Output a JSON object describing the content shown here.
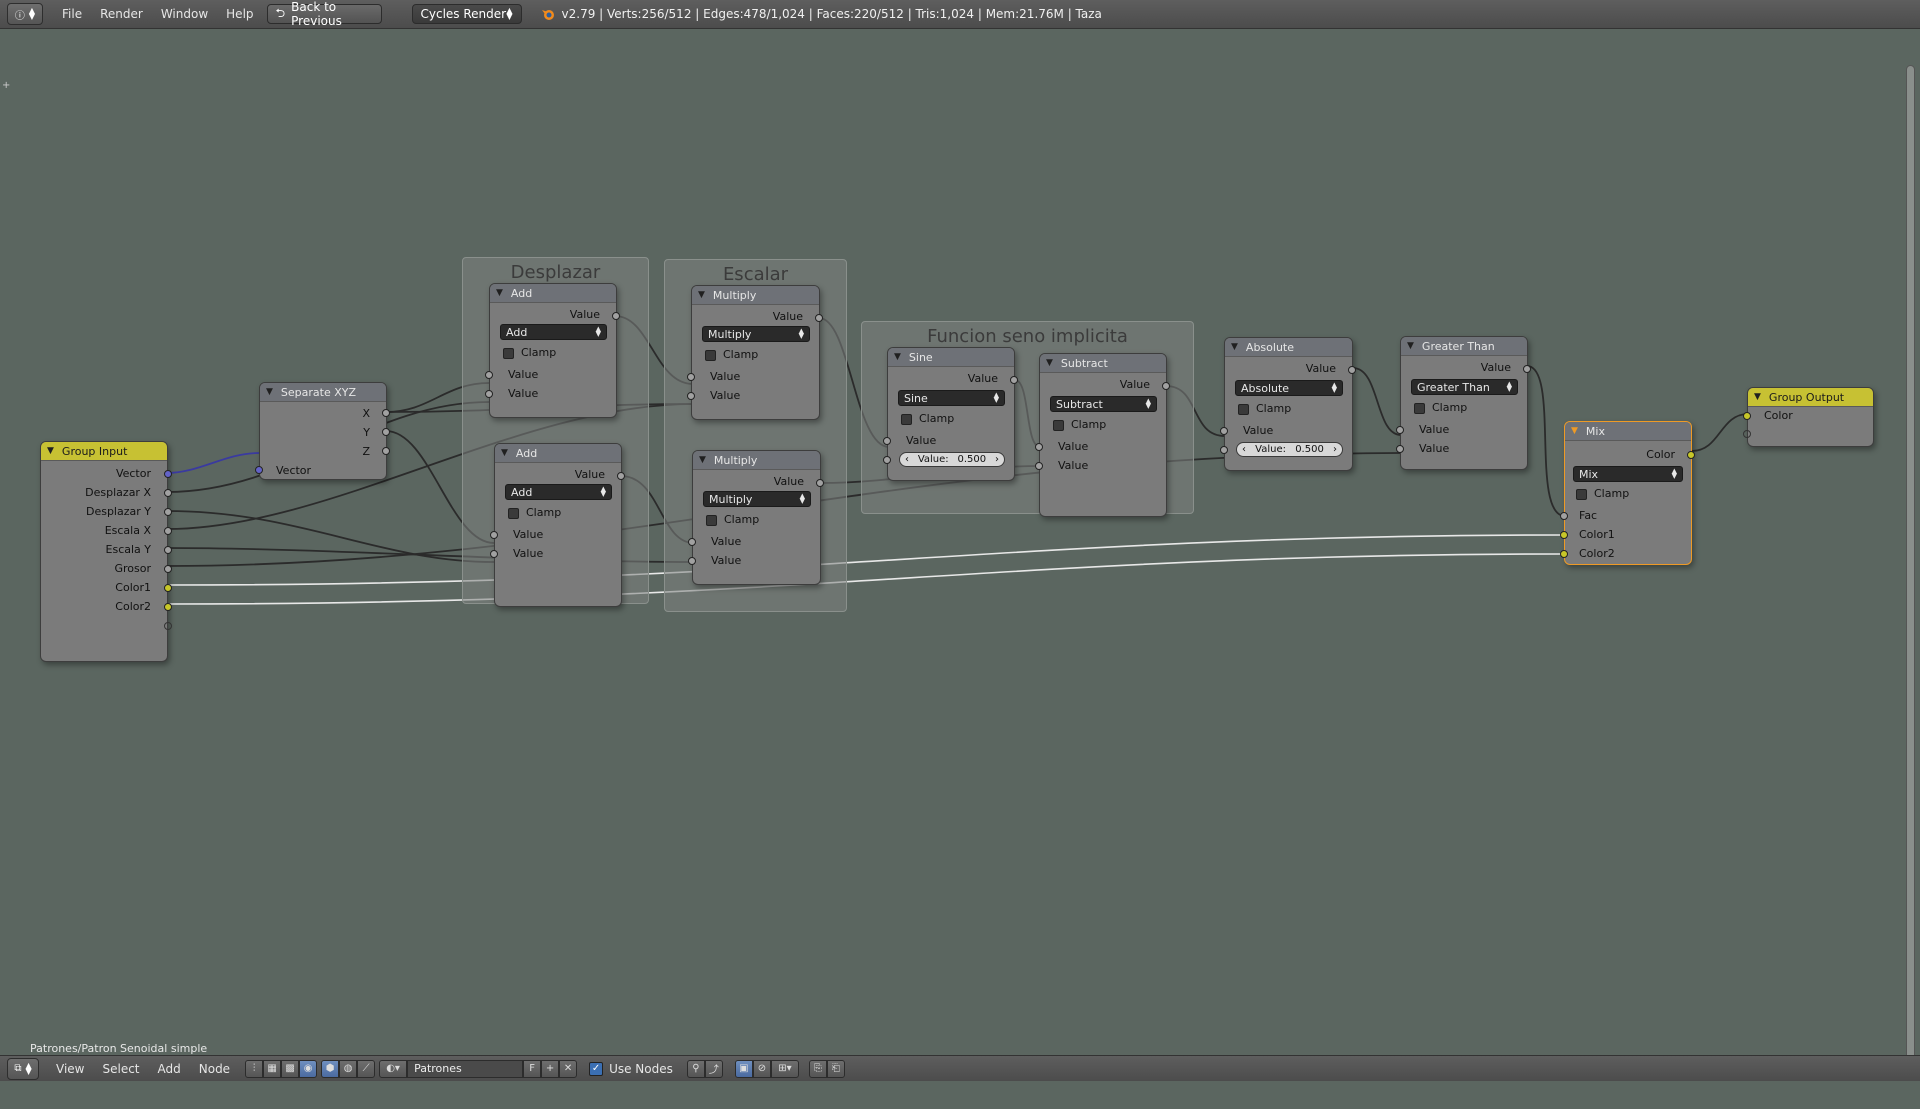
{
  "header": {
    "menus": [
      "File",
      "Render",
      "Window",
      "Help"
    ],
    "back_label": "Back to Previous",
    "engine": "Cycles Render",
    "stats": "v2.79 | Verts:256/512 | Edges:478/1,024 | Faces:220/512 | Tris:1,024 | Mem:21.76M | Taza"
  },
  "frames": {
    "desplazar": "Desplazar",
    "escalar": "Escalar",
    "funcion": "Funcion seno implicita"
  },
  "nodes": {
    "group_input": {
      "title": "Group Input",
      "outputs": [
        "Vector",
        "Desplazar X",
        "Desplazar Y",
        "Escala X",
        "Escala Y",
        "Grosor",
        "Color1",
        "Color2"
      ]
    },
    "separate_xyz": {
      "title": "Separate XYZ",
      "outputs": [
        "X",
        "Y",
        "Z"
      ],
      "input": "Vector"
    },
    "add1": {
      "title": "Add",
      "output": "Value",
      "op": "Add",
      "clamp": "Clamp",
      "in1": "Value",
      "in2": "Value"
    },
    "add2": {
      "title": "Add",
      "output": "Value",
      "op": "Add",
      "clamp": "Clamp",
      "in1": "Value",
      "in2": "Value"
    },
    "mul1": {
      "title": "Multiply",
      "output": "Value",
      "op": "Multiply",
      "clamp": "Clamp",
      "in1": "Value",
      "in2": "Value"
    },
    "mul2": {
      "title": "Multiply",
      "output": "Value",
      "op": "Multiply",
      "clamp": "Clamp",
      "in1": "Value",
      "in2": "Value"
    },
    "sine": {
      "title": "Sine",
      "output": "Value",
      "op": "Sine",
      "clamp": "Clamp",
      "in1": "Value",
      "field_label": "Value:",
      "field_value": "0.500"
    },
    "subtract": {
      "title": "Subtract",
      "output": "Value",
      "op": "Subtract",
      "clamp": "Clamp",
      "in1": "Value",
      "in2": "Value"
    },
    "absolute": {
      "title": "Absolute",
      "output": "Value",
      "op": "Absolute",
      "clamp": "Clamp",
      "in1": "Value",
      "field_label": "Value:",
      "field_value": "0.500"
    },
    "greater": {
      "title": "Greater Than",
      "output": "Value",
      "op": "Greater Than",
      "clamp": "Clamp",
      "in1": "Value",
      "in2": "Value"
    },
    "mix": {
      "title": "Mix",
      "output": "Color",
      "op": "Mix",
      "clamp": "Clamp",
      "fac": "Fac",
      "c1": "Color1",
      "c2": "Color2"
    },
    "group_output": {
      "title": "Group Output",
      "input": "Color"
    }
  },
  "canvas": {
    "path_label": "Patrones/Patron Senoidal simple"
  },
  "footer": {
    "menus": [
      "View",
      "Select",
      "Add",
      "Node"
    ],
    "material_name": "Patrones",
    "fake_user": "F",
    "use_nodes_label": "Use Nodes"
  }
}
